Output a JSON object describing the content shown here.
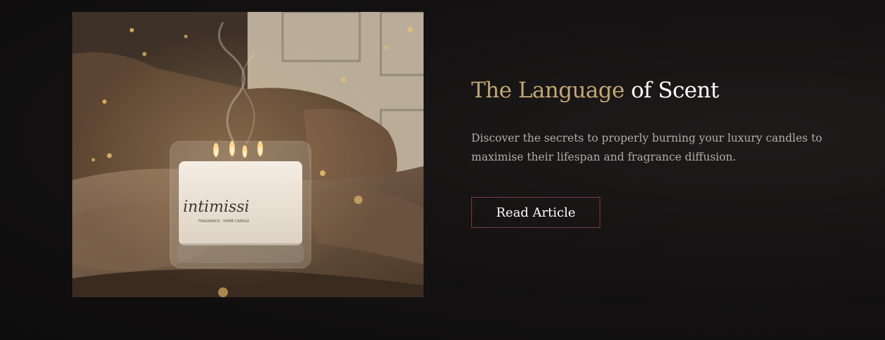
{
  "article": {
    "title_accent": "The Language",
    "title_rest": " of Scent",
    "description": "Discover the secrets to properly burning your luxury candles to maximise their lifespan and fragrance diffusion.",
    "button_label": "Read Article"
  },
  "image": {
    "brand_mark": "intimissi",
    "brand_sub": "FRAGRANCE · HOME CANDLE"
  },
  "colors": {
    "background": "#141212",
    "accent_gold": "#c2a773",
    "button_border": "#7c3a42",
    "text_body": "#b3aca6"
  }
}
